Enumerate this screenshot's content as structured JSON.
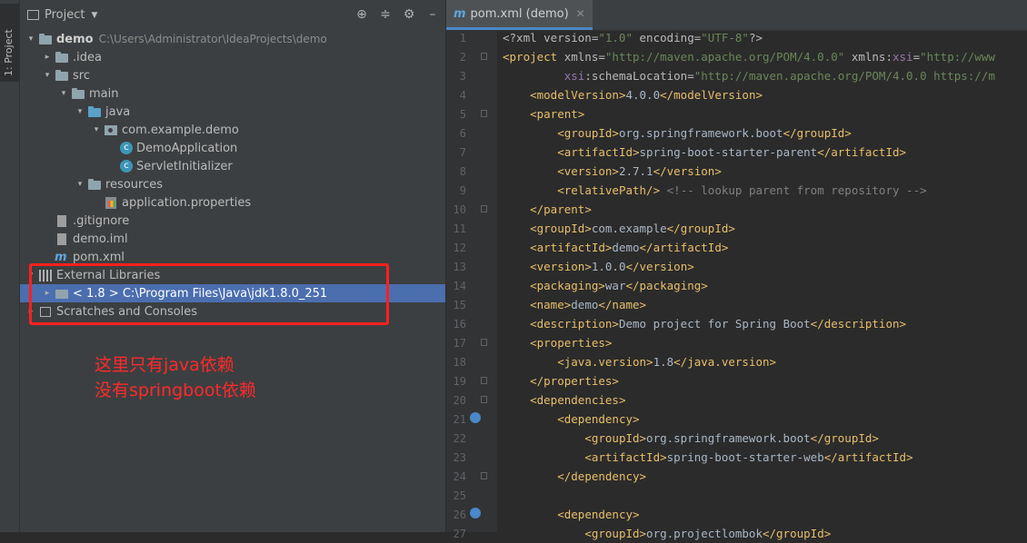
{
  "sidebar_tab": "1: Project",
  "project_panel": {
    "title": "Project",
    "icons": [
      "crosshair-icon",
      "collapse-icon",
      "gear-icon",
      "hide-icon"
    ],
    "tree": [
      {
        "indent": 0,
        "arrow": "▾",
        "icon": "folder",
        "label": "demo",
        "path": "C:\\Users\\Administrator\\IdeaProjects\\demo",
        "bold": true
      },
      {
        "indent": 1,
        "arrow": "▸",
        "icon": "folder",
        "label": ".idea"
      },
      {
        "indent": 1,
        "arrow": "▾",
        "icon": "folder",
        "label": "src"
      },
      {
        "indent": 2,
        "arrow": "▾",
        "icon": "folder",
        "label": "main"
      },
      {
        "indent": 3,
        "arrow": "▾",
        "icon": "folder-blue",
        "label": "java"
      },
      {
        "indent": 4,
        "arrow": "▾",
        "icon": "package",
        "label": "com.example.demo"
      },
      {
        "indent": 5,
        "arrow": "",
        "icon": "class",
        "label": "DemoApplication"
      },
      {
        "indent": 5,
        "arrow": "",
        "icon": "class",
        "label": "ServletInitializer"
      },
      {
        "indent": 3,
        "arrow": "▾",
        "icon": "folder",
        "label": "resources"
      },
      {
        "indent": 4,
        "arrow": "",
        "icon": "properties",
        "label": "application.properties"
      },
      {
        "indent": 1,
        "arrow": "",
        "icon": "file",
        "label": ".gitignore"
      },
      {
        "indent": 1,
        "arrow": "",
        "icon": "file",
        "label": "demo.iml"
      },
      {
        "indent": 1,
        "arrow": "",
        "icon": "maven",
        "label": "pom.xml"
      },
      {
        "indent": 0,
        "arrow": "▾",
        "icon": "libraries",
        "label": "External Libraries"
      },
      {
        "indent": 1,
        "arrow": "▸",
        "icon": "jdk",
        "label": "< 1.8 >  C:\\Program Files\\Java\\jdk1.8.0_251",
        "selected": true
      },
      {
        "indent": 0,
        "arrow": "▸",
        "icon": "scratches",
        "label": "Scratches and Consoles"
      }
    ]
  },
  "annotation": {
    "line1": "这里只有java依赖",
    "line2": "没有springboot依赖"
  },
  "editor": {
    "tab_label": "pom.xml (demo)",
    "lines": [
      {
        "n": "1",
        "mark": "",
        "html": "<span class='a'>&lt;?xml version=</span><span class='s'>\"1.0\"</span><span class='a'> encoding=</span><span class='s'>\"UTF-8\"</span><span class='a'>?&gt;</span>"
      },
      {
        "n": "2",
        "mark": "fold",
        "html": "<span class='t'>&lt;project </span><span class='a'>xmlns=</span><span class='s'>\"http://maven.apache.org/POM/4.0.0\"</span><span class='a'> xmlns:</span><span class='ns'>xsi</span><span class='a'>=</span><span class='s'>\"http://www</span>"
      },
      {
        "n": "3",
        "mark": "",
        "html": "         <span class='ns'>xsi</span><span class='a'>:schemaLocation=</span><span class='s'>\"http://maven.apache.org/POM/4.0.0 https://m</span>"
      },
      {
        "n": "4",
        "mark": "",
        "html": "    <span class='t'>&lt;modelVersion&gt;</span>4.0.0<span class='t'>&lt;/modelVersion&gt;</span>"
      },
      {
        "n": "5",
        "mark": "fold",
        "html": "    <span class='t'>&lt;parent&gt;</span>"
      },
      {
        "n": "6",
        "mark": "",
        "html": "        <span class='t'>&lt;groupId&gt;</span>org.springframework.boot<span class='t'>&lt;/groupId&gt;</span>"
      },
      {
        "n": "7",
        "mark": "",
        "html": "        <span class='t'>&lt;artifactId&gt;</span>spring-boot-starter-parent<span class='t'>&lt;/artifactId&gt;</span>"
      },
      {
        "n": "8",
        "mark": "",
        "html": "        <span class='t'>&lt;version&gt;</span>2.7.1<span class='t'>&lt;/version&gt;</span>"
      },
      {
        "n": "9",
        "mark": "",
        "html": "        <span class='t'>&lt;relativePath/&gt;</span> <span class='c'>&lt;!-- lookup parent from repository --&gt;</span>"
      },
      {
        "n": "10",
        "mark": "fold",
        "html": "    <span class='t'>&lt;/parent&gt;</span>"
      },
      {
        "n": "11",
        "mark": "",
        "html": "    <span class='t'>&lt;groupId&gt;</span>com.example<span class='t'>&lt;/groupId&gt;</span>"
      },
      {
        "n": "12",
        "mark": "",
        "html": "    <span class='t'>&lt;artifactId&gt;</span>demo<span class='t'>&lt;/artifactId&gt;</span>"
      },
      {
        "n": "13",
        "mark": "",
        "html": "    <span class='t'>&lt;version&gt;</span>1.0.0<span class='t'>&lt;/version&gt;</span>"
      },
      {
        "n": "14",
        "mark": "",
        "html": "    <span class='t'>&lt;packaging&gt;</span>war<span class='t'>&lt;/packaging&gt;</span>"
      },
      {
        "n": "15",
        "mark": "",
        "html": "    <span class='t'>&lt;name&gt;</span>demo<span class='t'>&lt;/name&gt;</span>"
      },
      {
        "n": "16",
        "mark": "",
        "html": "    <span class='t'>&lt;description&gt;</span>Demo project for Spring Boot<span class='t'>&lt;/description&gt;</span>"
      },
      {
        "n": "17",
        "mark": "fold",
        "html": "    <span class='t'>&lt;properties&gt;</span>"
      },
      {
        "n": "18",
        "mark": "",
        "html": "        <span class='t'>&lt;java.version&gt;</span>1.8<span class='t'>&lt;/java.version&gt;</span>"
      },
      {
        "n": "19",
        "mark": "fold",
        "html": "    <span class='t'>&lt;/properties&gt;</span>"
      },
      {
        "n": "20",
        "mark": "fold",
        "html": "    <span class='t'>&lt;dependencies&gt;</span>"
      },
      {
        "n": "21",
        "mark": "run",
        "html": "        <span class='t'>&lt;dependency&gt;</span>"
      },
      {
        "n": "22",
        "mark": "",
        "html": "            <span class='t'>&lt;groupId&gt;</span>org.springframework.boot<span class='t'>&lt;/groupId&gt;</span>"
      },
      {
        "n": "23",
        "mark": "",
        "html": "            <span class='t'>&lt;artifactId&gt;</span>spring-boot-starter-web<span class='t'>&lt;/artifactId&gt;</span>"
      },
      {
        "n": "24",
        "mark": "fold",
        "html": "        <span class='t'>&lt;/dependency&gt;</span>"
      },
      {
        "n": "25",
        "mark": "",
        "html": ""
      },
      {
        "n": "26",
        "mark": "run",
        "html": "        <span class='t'>&lt;dependency&gt;</span>"
      },
      {
        "n": "27",
        "mark": "",
        "html": "            <span class='t'>&lt;groupId&gt;</span>org.projectlombok<span class='t'>&lt;/groupId&gt;</span>"
      }
    ]
  }
}
